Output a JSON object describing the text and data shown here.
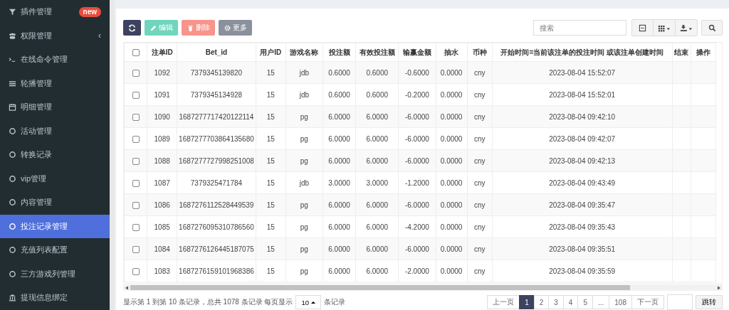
{
  "sidebar": {
    "items": [
      {
        "label": "插件管理",
        "kind": "funnel",
        "badge": "new",
        "selected": false
      },
      {
        "label": "权限管理",
        "kind": "users",
        "caret": "‹",
        "selected": false
      },
      {
        "label": "在线命令管理",
        "kind": "terminal",
        "selected": false
      },
      {
        "label": "轮播管理",
        "kind": "bars",
        "selected": false
      },
      {
        "label": "明细管理",
        "kind": "calendar",
        "selected": false
      },
      {
        "label": "活动管理",
        "kind": "circle",
        "selected": false
      },
      {
        "label": "转换记录",
        "kind": "circle",
        "selected": false
      },
      {
        "label": "vip管理",
        "kind": "circle",
        "selected": false
      },
      {
        "label": "内容管理",
        "kind": "circle",
        "selected": false
      },
      {
        "label": "投注记录管理",
        "kind": "circle",
        "selected": true
      },
      {
        "label": "充值列表配置",
        "kind": "circle",
        "selected": false
      },
      {
        "label": "三方游戏列管理",
        "kind": "circle",
        "selected": false
      },
      {
        "label": "提现信息绑定",
        "kind": "bank",
        "selected": false
      }
    ]
  },
  "toolbar": {
    "buttons": [
      {
        "kind": "refresh"
      },
      {
        "kind": "edit",
        "label": "编辑"
      },
      {
        "kind": "delete",
        "label": "删除"
      },
      {
        "kind": "more",
        "label": "更多"
      }
    ],
    "search": {
      "placeholder": "搜索"
    }
  },
  "table": {
    "select_all_checked": false,
    "columns": [
      "注单ID",
      "Bet_id",
      "用户ID",
      "游戏名称",
      "投注额",
      "有效投注额",
      "输赢金额",
      "抽水",
      "币种",
      "开始时间=当前该注单的投注时间 或该注单创建时间",
      "结束",
      "操作"
    ],
    "rows": [
      {
        "checked": false,
        "cells": [
          "1092",
          "7379345139820",
          "15",
          "jdb",
          "0.6000",
          "0.6000",
          "-0.6000",
          "0.0000",
          "cny",
          "2023-08-04 15:52:07"
        ]
      },
      {
        "checked": false,
        "cells": [
          "1091",
          "7379345134928",
          "15",
          "jdb",
          "0.6000",
          "0.6000",
          "-0.2000",
          "0.0000",
          "cny",
          "2023-08-04 15:52:01"
        ]
      },
      {
        "checked": false,
        "cells": [
          "1090",
          "1687277717420122114",
          "15",
          "pg",
          "6.0000",
          "6.0000",
          "-6.0000",
          "0.0000",
          "cny",
          "2023-08-04 09:42:10"
        ]
      },
      {
        "checked": false,
        "cells": [
          "1089",
          "1687277703864135680",
          "15",
          "pg",
          "6.0000",
          "6.0000",
          "-6.0000",
          "0.0000",
          "cny",
          "2023-08-04 09:42:07"
        ]
      },
      {
        "checked": false,
        "cells": [
          "1088",
          "1687277727998251008",
          "15",
          "pg",
          "6.0000",
          "6.0000",
          "-6.0000",
          "0.0000",
          "cny",
          "2023-08-04 09:42:13"
        ]
      },
      {
        "checked": false,
        "cells": [
          "1087",
          "7379325471784",
          "15",
          "jdb",
          "3.0000",
          "3.0000",
          "-1.2000",
          "0.0000",
          "cny",
          "2023-08-04 09:43:49"
        ]
      },
      {
        "checked": false,
        "cells": [
          "1086",
          "1687276112528449539",
          "15",
          "pg",
          "6.0000",
          "6.0000",
          "-6.0000",
          "0.0000",
          "cny",
          "2023-08-04 09:35:47"
        ]
      },
      {
        "checked": false,
        "cells": [
          "1085",
          "1687276095310786560",
          "15",
          "pg",
          "6.0000",
          "6.0000",
          "-4.2000",
          "0.0000",
          "cny",
          "2023-08-04 09:35:43"
        ]
      },
      {
        "checked": false,
        "cells": [
          "1084",
          "1687276126445187075",
          "15",
          "pg",
          "6.0000",
          "6.0000",
          "-6.0000",
          "0.0000",
          "cny",
          "2023-08-04 09:35:51"
        ]
      },
      {
        "checked": false,
        "cells": [
          "1083",
          "1687276159101968386",
          "15",
          "pg",
          "6.0000",
          "6.0000",
          "-2.0000",
          "0.0000",
          "cny",
          "2023-08-04 09:35:59"
        ]
      }
    ]
  },
  "footer": {
    "summary": "显示第 1 到第 10 条记录，总共 1078 条记录 每页显示",
    "page_size": "10",
    "page_size_suffix": "条记录",
    "pages": [
      {
        "label": "上一页",
        "selected": false
      },
      {
        "label": "1",
        "selected": true
      },
      {
        "label": "2",
        "selected": false
      },
      {
        "label": "3",
        "selected": false
      },
      {
        "label": "4",
        "selected": false
      },
      {
        "label": "5",
        "selected": false
      },
      {
        "label": "...",
        "selected": false
      },
      {
        "label": "108",
        "selected": false
      },
      {
        "label": "下一页",
        "selected": false
      }
    ],
    "jump_label": "跳转"
  }
}
